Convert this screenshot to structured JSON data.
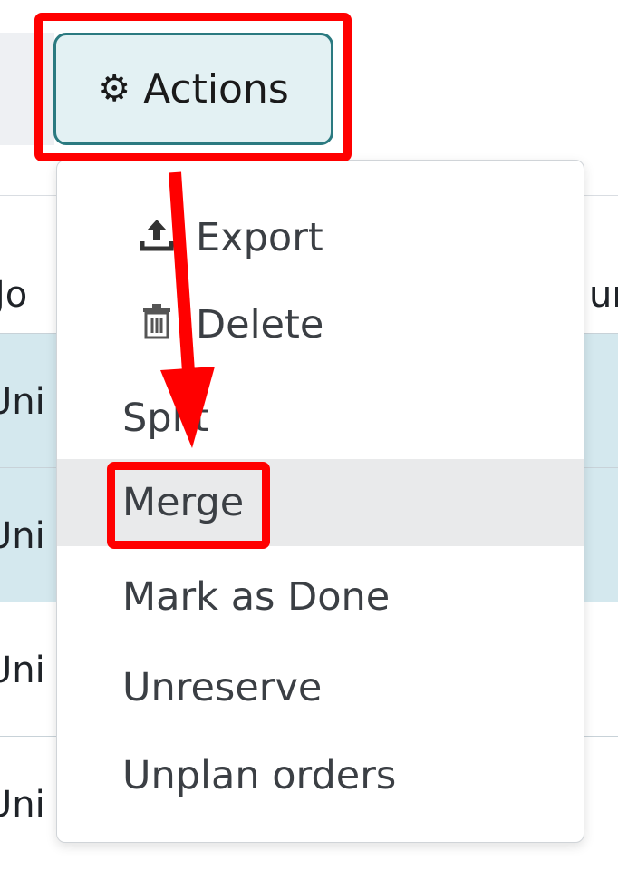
{
  "actions_button": {
    "label": "Actions",
    "icon": "gear-icon"
  },
  "table": {
    "header_left": "Jo",
    "header_right": "ur",
    "rows": [
      {
        "text": "Uni",
        "selected": true
      },
      {
        "text": "Uni",
        "selected": true
      },
      {
        "text": "Uni",
        "selected": false
      },
      {
        "text": "Uni",
        "selected": false
      }
    ]
  },
  "menu": {
    "items": [
      {
        "label": "Export",
        "icon": "upload-icon"
      },
      {
        "label": "Delete",
        "icon": "trash-icon"
      },
      {
        "label": "Split"
      },
      {
        "label": "Merge"
      },
      {
        "label": "Mark as Done"
      },
      {
        "label": "Unreserve"
      },
      {
        "label": "Unplan orders"
      }
    ]
  },
  "annotation_color": "#ff0000"
}
